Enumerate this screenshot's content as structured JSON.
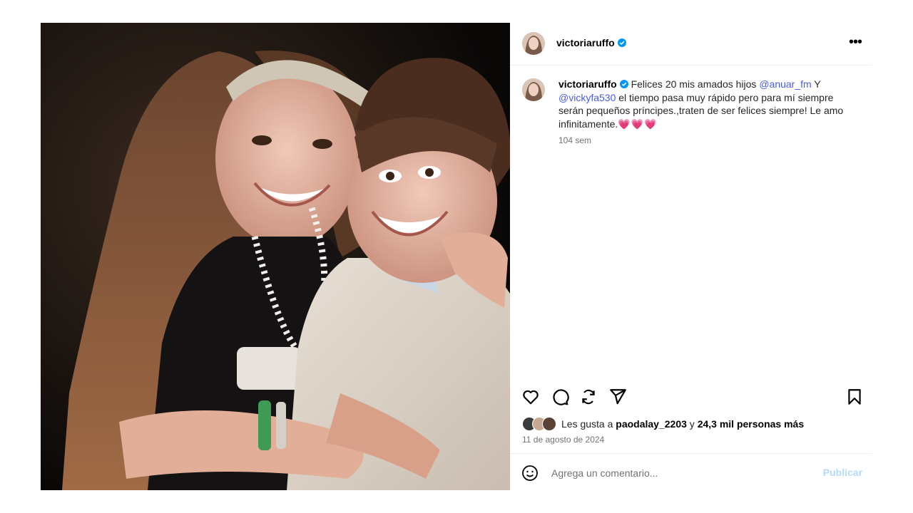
{
  "post": {
    "username": "victoriaruffo",
    "verified": true,
    "more_icon": "more-horizontal-icon"
  },
  "caption": {
    "username": "victoriaruffo",
    "text_1": "Felices 20 mis amados hijos ",
    "mention_1": "@anuar_fm",
    "text_2": " Y ",
    "mention_2": "@vickyfa530",
    "text_3": " el tiempo pasa muy rápido pero para mí siempre serán pequeños príncipes.,traten de ser felices siempre! Le amo infinitamente.",
    "hearts": "💗💗💗",
    "time_ago": "104 sem"
  },
  "actions": {
    "like_icon": "heart-icon",
    "comment_icon": "comment-icon",
    "repost_icon": "repost-icon",
    "share_icon": "send-icon",
    "save_icon": "bookmark-icon"
  },
  "likes": {
    "prefix": "Les gusta a ",
    "user": "paodalay_2203",
    "middle": " y ",
    "count": "24,3 mil personas más"
  },
  "date": "11 de agosto de 2024",
  "comment": {
    "placeholder": "Agrega un comentario...",
    "publish_label": "Publicar"
  },
  "colors": {
    "verified": "#0095f6",
    "mention": "#4a5ee0",
    "publish": "#b3dbff"
  }
}
